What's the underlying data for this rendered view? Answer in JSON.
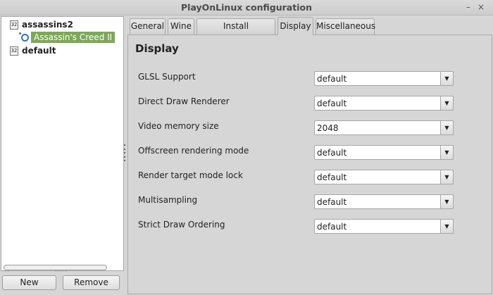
{
  "window": {
    "title": "PlayOnLinux configuration",
    "minimize_glyph": "–",
    "close_glyph": "×"
  },
  "tree": {
    "items": [
      {
        "badge": "32",
        "label": "assassins2"
      },
      {
        "label": "Assassin's Creed II",
        "icon": "ubisoft-icon",
        "selected": true
      },
      {
        "badge": "32",
        "label": "default"
      }
    ]
  },
  "buttons": {
    "new": "New",
    "remove": "Remove"
  },
  "tabs": [
    {
      "label": "General"
    },
    {
      "label": "Wine"
    },
    {
      "label": "Install components"
    },
    {
      "label": "Display",
      "active": true
    },
    {
      "label": "Miscellaneous"
    }
  ],
  "display": {
    "title": "Display",
    "settings": [
      {
        "label": "GLSL Support",
        "value": "default"
      },
      {
        "label": "Direct Draw Renderer",
        "value": "default"
      },
      {
        "label": "Video memory size",
        "value": "2048"
      },
      {
        "label": "Offscreen rendering mode",
        "value": "default"
      },
      {
        "label": "Render target mode lock",
        "value": "default"
      },
      {
        "label": "Multisampling",
        "value": "default"
      },
      {
        "label": "Strict Draw Ordering",
        "value": "default"
      }
    ]
  },
  "colors": {
    "selection": "#7fa65a",
    "icon_blue": "#2f6fc4"
  }
}
